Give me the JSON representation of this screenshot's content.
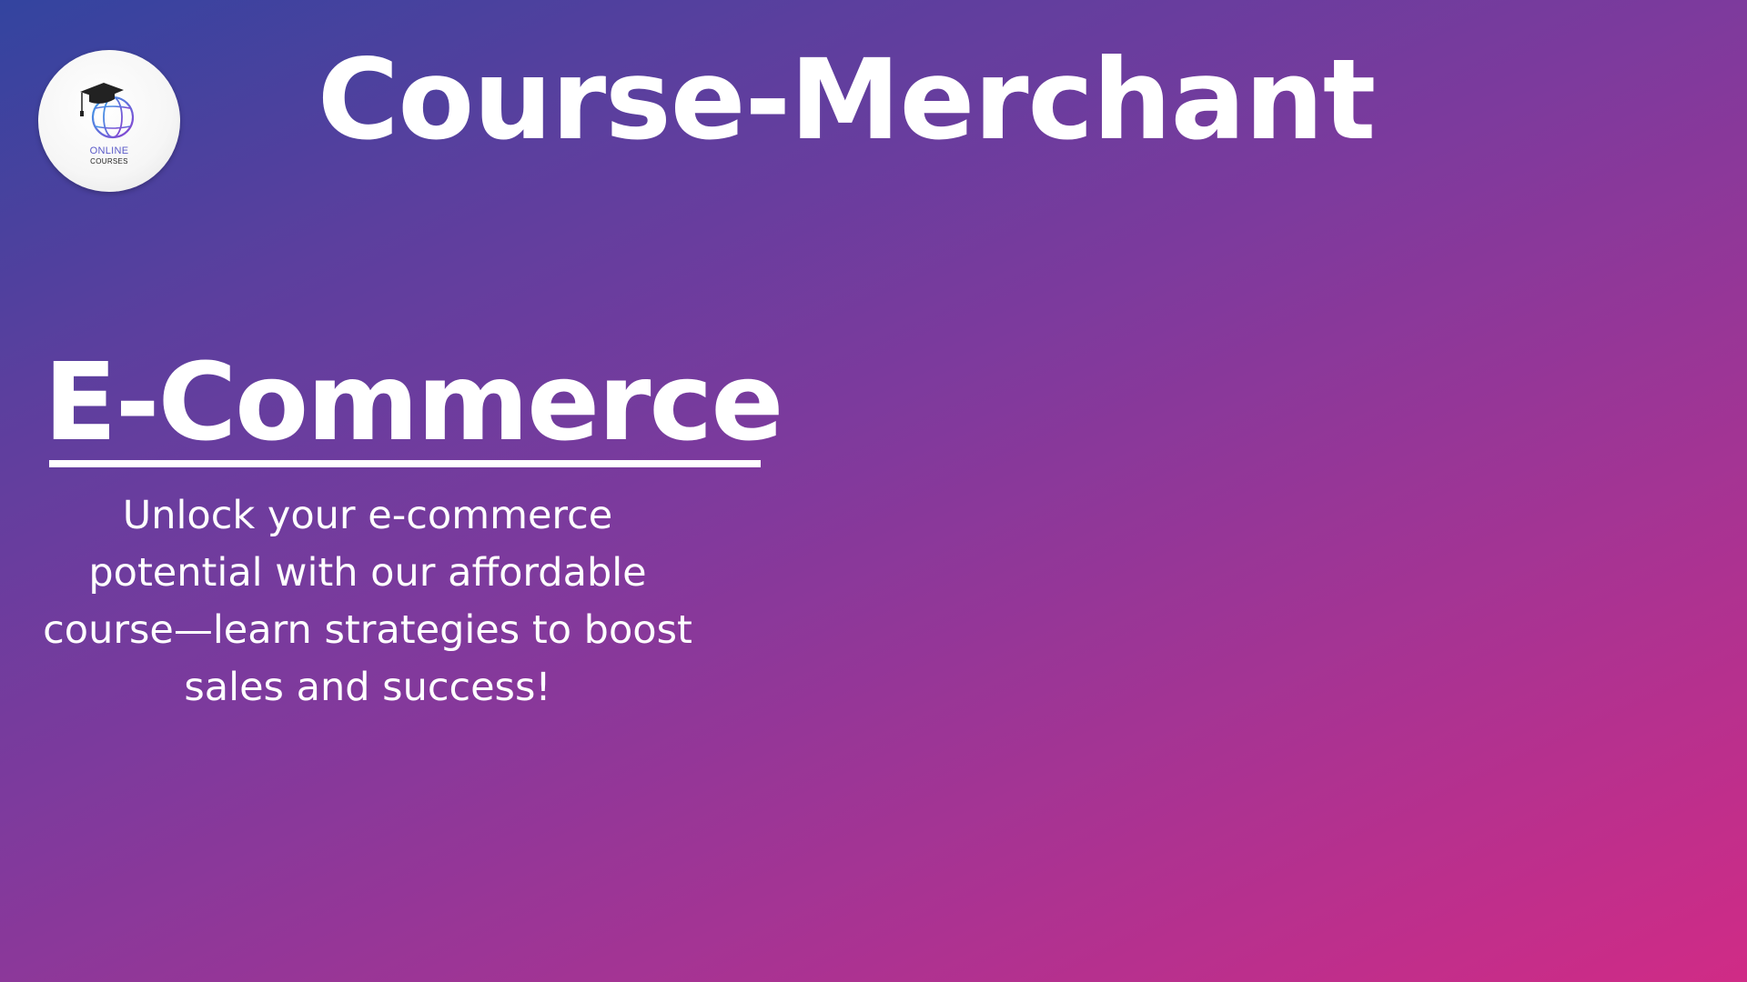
{
  "logo": {
    "icon": "graduation-globe-icon",
    "line1": "ONLINE",
    "line2": "COURSES"
  },
  "brand_title": "Course-Merchant",
  "section_title": "E-Commerce",
  "description": "Unlock your e-commerce potential with our affordable course—learn strategies to boost sales and success!",
  "colors": {
    "gradient_start": "#33449f",
    "gradient_mid": "#7d3a9d",
    "gradient_end": "#d02b86",
    "text": "#ffffff"
  }
}
